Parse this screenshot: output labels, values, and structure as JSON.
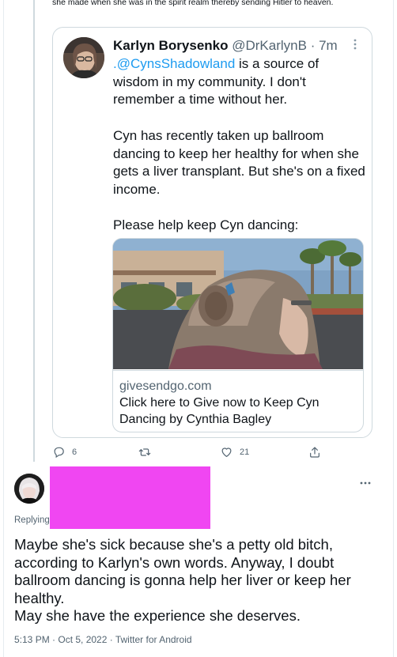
{
  "previous_tweet": {
    "text": "she made when she was in the spirit realm thereby sending Hitler to heaven."
  },
  "quoted_tweet": {
    "name": "Karlyn Borysenko",
    "handle": "@DrKarlynB",
    "time": "· 7m",
    "more_icon": "more-vertical-icon",
    "paragraphs": [
      {
        "mention": ".@CynsShadowland",
        "text": " is a source of wisdom in my community. I don't remember a time without her."
      },
      {
        "mention": "",
        "text": "Cyn has recently taken up ballroom dancing to keep her healthy for when she gets a liver transplant. But she's on a fixed income."
      },
      {
        "mention": "",
        "text": "Please help keep Cyn dancing:"
      }
    ],
    "link_card": {
      "domain": "givesendgo.com",
      "title": "Click here to Give now to Keep Cyn Dancing by Cynthia Bagley"
    }
  },
  "actions": {
    "replies": "6",
    "retweets": "",
    "likes": "21",
    "share": ""
  },
  "reply": {
    "replying_label": "Replying",
    "text": "Maybe she's sick because she's a petty old bitch, according to Karlyn's own words. Anyway, I doubt ballroom dancing is gonna help her liver or keep her healthy.\nMay she have the experience she deserves.",
    "meta": "5:13 PM · Oct 5, 2022 · Twitter for Android",
    "redaction_color": "#f046f2"
  },
  "colors": {
    "accent": "#1d9bf0",
    "secondary_text": "#536471",
    "border": "#cfd9de"
  }
}
